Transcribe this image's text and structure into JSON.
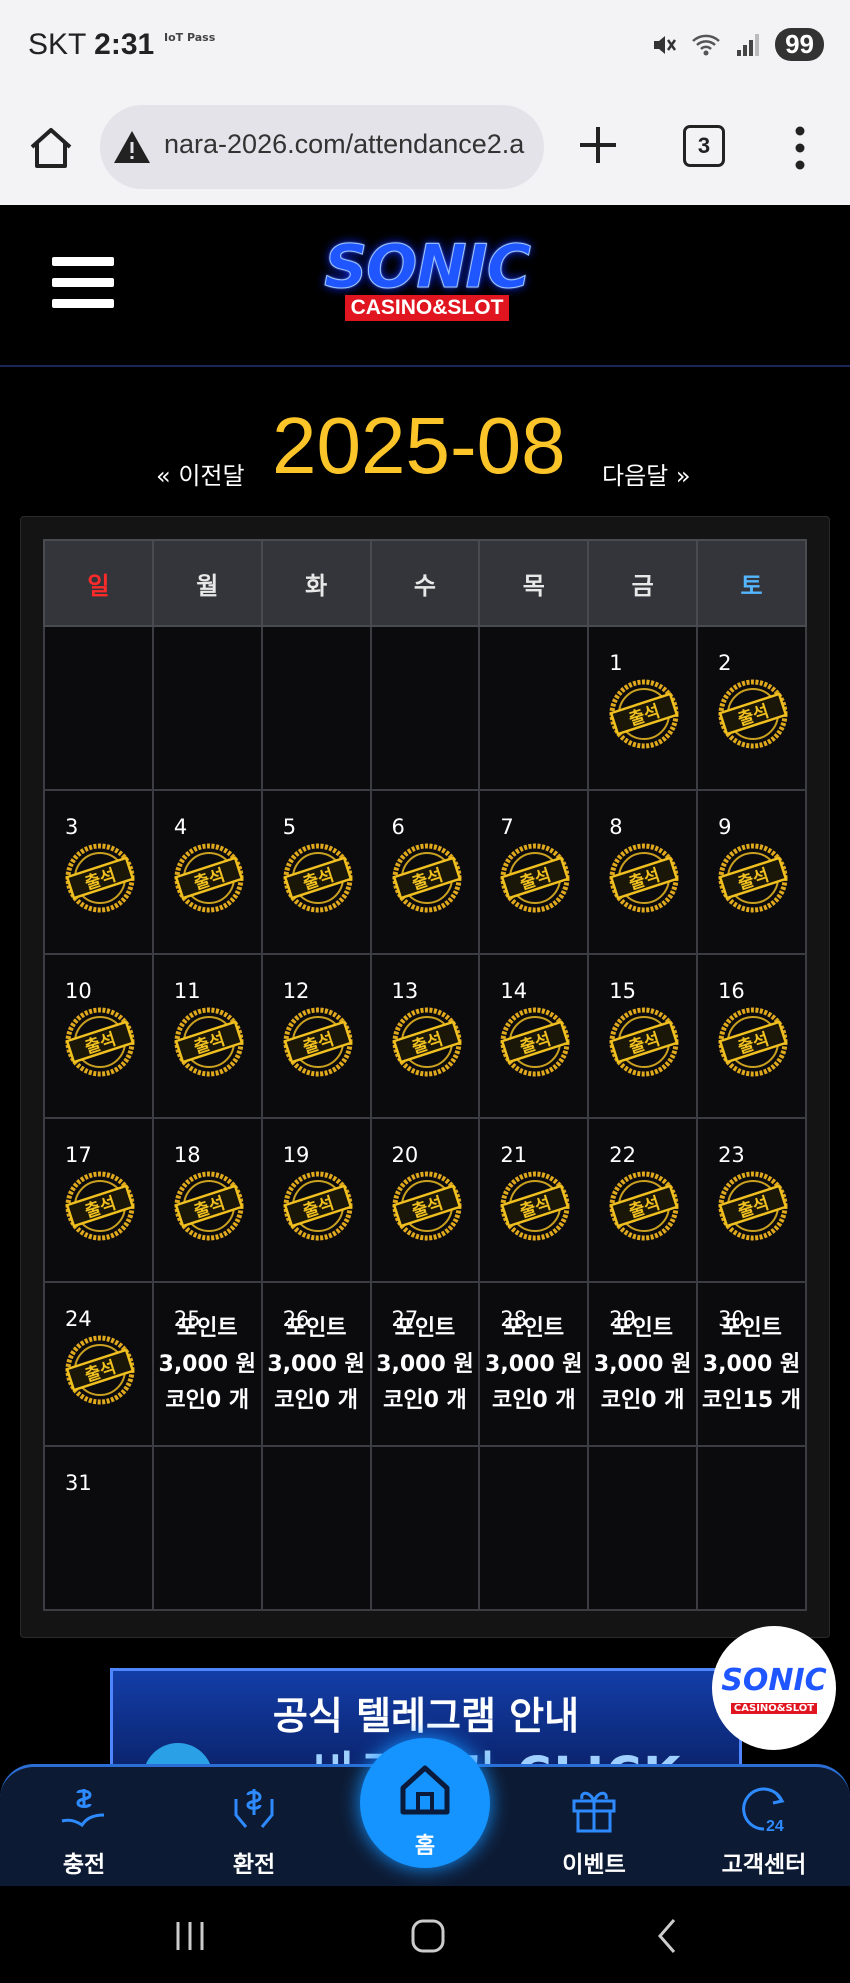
{
  "status_bar": {
    "carrier": "SKT",
    "time": "2:31",
    "iot_badge": "IoT Pass",
    "battery": "99"
  },
  "browser": {
    "url": "nara-2026.com/attendance2.a",
    "tab_count": "3"
  },
  "site": {
    "logo_main": "SONIC",
    "logo_sub": "CASINO&SLOT"
  },
  "month_nav": {
    "prev": "« 이전달",
    "title": "2025-08",
    "next": "다음달 »"
  },
  "calendar": {
    "weekdays": [
      "일",
      "월",
      "화",
      "수",
      "목",
      "금",
      "토"
    ],
    "stamp_text": "출석",
    "attended_days": [
      1,
      2,
      3,
      4,
      5,
      6,
      7,
      8,
      9,
      10,
      11,
      12,
      13,
      14,
      15,
      16,
      17,
      18,
      19,
      20,
      21,
      22,
      23,
      24
    ],
    "info_cells": {
      "25": {
        "point": "포인트",
        "amount": "3,000 원",
        "coin": "코인0 개"
      },
      "26": {
        "point": "포인트",
        "amount": "3,000 원",
        "coin": "코인0 개"
      },
      "27": {
        "point": "포인트",
        "amount": "3,000 원",
        "coin": "코인0 개"
      },
      "28": {
        "point": "포인트",
        "amount": "3,000 원",
        "coin": "코인0 개"
      },
      "29": {
        "point": "포인트",
        "amount": "3,000 원",
        "coin": "코인0 개"
      },
      "30": {
        "point": "포인트",
        "amount": "3,000 원",
        "coin": "코인15 개"
      }
    }
  },
  "banner": {
    "title": "공식 텔레그램 안내",
    "cta": "바로가기 CLICK"
  },
  "fab": {
    "logo_main": "SONIC",
    "logo_sub": "CASINO&SLOT"
  },
  "bottom_nav": {
    "deposit": "충전",
    "withdraw": "환전",
    "home": "홈",
    "event": "이벤트",
    "support": "고객센터"
  },
  "colors": {
    "accent_gold": "#fbc52a",
    "home_blue": "#1593ff",
    "sunday_red": "#ff2a2a",
    "saturday_blue": "#55b6ff"
  }
}
